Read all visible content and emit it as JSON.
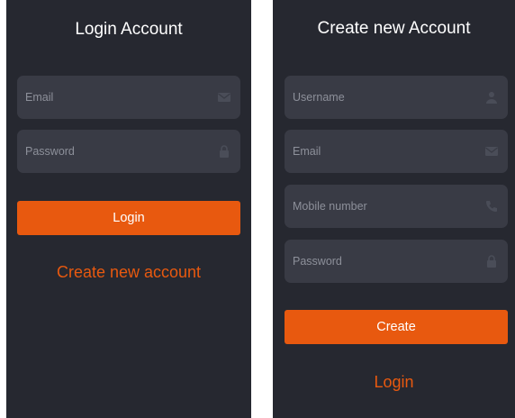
{
  "login": {
    "title": "Login Account",
    "email_placeholder": "Email",
    "password_placeholder": "Password",
    "login_button": "Login",
    "create_link": "Create new account"
  },
  "create": {
    "title": "Create new Account",
    "username_placeholder": "Username",
    "email_placeholder": "Email",
    "mobile_placeholder": "Mobile number",
    "password_placeholder": "Password",
    "create_button": "Create",
    "login_link": "Login"
  },
  "icons": {
    "email": "mail-icon",
    "password": "lock-icon",
    "username": "user-icon",
    "mobile": "phone-icon"
  },
  "colors": {
    "background": "#262830",
    "field": "#393b45",
    "accent": "#e8590f",
    "placeholder": "#8d909a"
  }
}
